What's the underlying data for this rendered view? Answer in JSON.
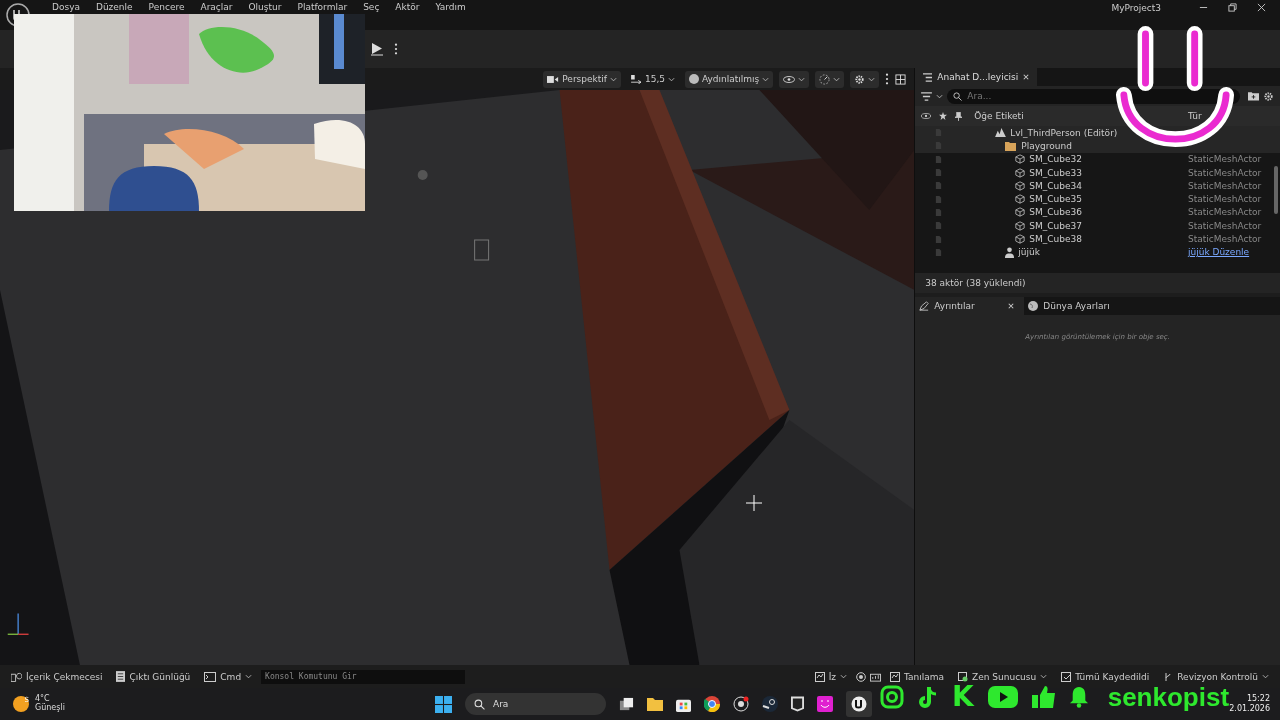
{
  "menu_bar": {
    "items": [
      "Dosya",
      "Düzenle",
      "Pencere",
      "Araçlar",
      "Oluştur",
      "Platformlar",
      "Seç",
      "Aktör",
      "Yardım"
    ],
    "project": "MyProject3"
  },
  "viewport": {
    "toolbar": [
      {
        "kind": "camera",
        "label": "Perspektif"
      },
      {
        "kind": "speed",
        "label": "15,5"
      },
      {
        "kind": "lighting",
        "label": "Aydınlatılmış"
      },
      {
        "kind": "show"
      },
      {
        "kind": "realtime"
      },
      {
        "kind": "settings"
      }
    ]
  },
  "outliner": {
    "tab": "Anahat D...leyicisi",
    "search_placeholder": "Ara...",
    "columns": [
      "Öğe Etiketi",
      "Tür"
    ],
    "tree": [
      {
        "kind": "level",
        "label": "Lvl_ThirdPerson (Editör)",
        "children": [
          {
            "kind": "folder",
            "label": "Playground",
            "children": [
              {
                "kind": "mesh",
                "label": "SM_Cube32",
                "type": "StaticMeshActor"
              },
              {
                "kind": "mesh",
                "label": "SM_Cube33",
                "type": "StaticMeshActor"
              },
              {
                "kind": "mesh",
                "label": "SM_Cube34",
                "type": "StaticMeshActor"
              },
              {
                "kind": "mesh",
                "label": "SM_Cube35",
                "type": "StaticMeshActor"
              },
              {
                "kind": "mesh",
                "label": "SM_Cube36",
                "type": "StaticMeshActor"
              },
              {
                "kind": "mesh",
                "label": "SM_Cube37",
                "type": "StaticMeshActor"
              },
              {
                "kind": "mesh",
                "label": "SM_Cube38",
                "type": "StaticMeshActor"
              }
            ]
          },
          {
            "kind": "character",
            "label": "jüjük",
            "type": "jüjük Düzenle"
          }
        ]
      }
    ],
    "status": "38 aktör (38 yüklendi)"
  },
  "details": {
    "tabs": [
      {
        "label": "Ayrıntılar",
        "selected": true
      },
      {
        "label": "Dünya Ayarları",
        "selected": false
      }
    ],
    "message": "Ayrıntıları görüntülemek için bir obje seç."
  },
  "bottom_bar": {
    "left": [
      {
        "kind": "drawer",
        "label": "İçerik Çekmecesi"
      },
      {
        "kind": "log",
        "label": "Çıktı Günlüğü"
      },
      {
        "kind": "cmd",
        "label": "Cmd"
      }
    ],
    "console_placeholder": "Konsol Komutunu Gir",
    "right": [
      {
        "kind": "trace",
        "label": "İz"
      },
      {
        "kind": "icons"
      },
      {
        "kind": "insights",
        "label": "Tanılama"
      },
      {
        "kind": "zen",
        "label": "Zen Sunucusu"
      },
      {
        "kind": "save",
        "label": "Tümü Kaydedildi"
      },
      {
        "kind": "revision",
        "label": "Revizyon Kontrolü"
      }
    ]
  },
  "taskbar": {
    "weather_badge": "S",
    "weather_temp": "4°C",
    "weather_text": "Güneşli",
    "search_placeholder": "Ara",
    "time": "15:22",
    "date": "2.01.2026"
  },
  "overlay": {
    "letter_icon": "K",
    "brand": "senkopist"
  }
}
